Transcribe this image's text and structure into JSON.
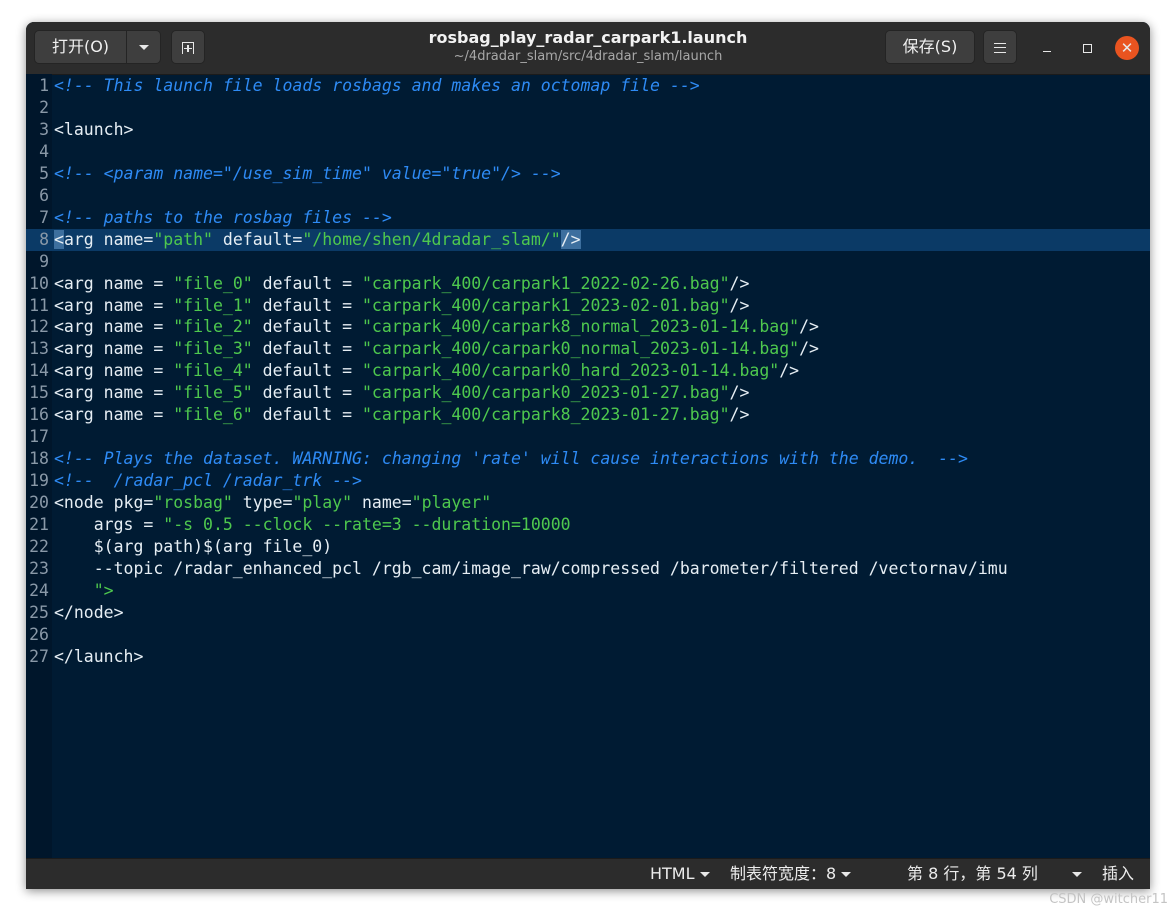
{
  "header": {
    "open_label": "打开(O)",
    "title": "rosbag_play_radar_carpark1.launch",
    "subtitle": "~/4dradar_slam/src/4dradar_slam/launch",
    "save_label": "保存(S)",
    "close_glyph": "✕"
  },
  "icons": [
    "chevron-down-icon",
    "new-tab-icon",
    "hamburger-menu-icon",
    "minimize-icon",
    "maximize-icon",
    "close-icon"
  ],
  "colors": {
    "editor_bg": "#001b33",
    "comment": "#2e8bf5",
    "string": "#4ec84e",
    "text": "#e6eef4",
    "current_line": "#0b3a66",
    "close_button": "#e95420"
  },
  "editor": {
    "current_line": 8,
    "lines": [
      {
        "n": "1",
        "t": "<!-- This launch file loads rosbags and makes an octomap file -->"
      },
      {
        "n": "2",
        "t": ""
      },
      {
        "n": "3",
        "t": "<launch>"
      },
      {
        "n": "4",
        "t": ""
      },
      {
        "n": "5",
        "t": "<!-- <param name=\"/use_sim_time\" value=\"true\"/> -->"
      },
      {
        "n": "6",
        "t": ""
      },
      {
        "n": "7",
        "t": "<!-- paths to the rosbag files -->"
      },
      {
        "n": "8",
        "t": "<arg name=\"path\" default=\"/home/shen/4dradar_slam/\"/>"
      },
      {
        "n": "9",
        "t": ""
      },
      {
        "n": "10",
        "t": "<arg name = \"file_0\" default = \"carpark_400/carpark1_2022-02-26.bag\"/>"
      },
      {
        "n": "11",
        "t": "<arg name = \"file_1\" default = \"carpark_400/carpark1_2023-02-01.bag\"/>"
      },
      {
        "n": "12",
        "t": "<arg name = \"file_2\" default = \"carpark_400/carpark8_normal_2023-01-14.bag\"/>"
      },
      {
        "n": "13",
        "t": "<arg name = \"file_3\" default = \"carpark_400/carpark0_normal_2023-01-14.bag\"/>"
      },
      {
        "n": "14",
        "t": "<arg name = \"file_4\" default = \"carpark_400/carpark0_hard_2023-01-14.bag\"/>"
      },
      {
        "n": "15",
        "t": "<arg name = \"file_5\" default = \"carpark_400/carpark0_2023-01-27.bag\"/>"
      },
      {
        "n": "16",
        "t": "<arg name = \"file_6\" default = \"carpark_400/carpark8_2023-01-27.bag\"/>"
      },
      {
        "n": "17",
        "t": ""
      },
      {
        "n": "18",
        "t": "<!-- Plays the dataset. WARNING: changing 'rate' will cause interactions with the demo.  -->"
      },
      {
        "n": "19",
        "t": "<!--  /radar_pcl /radar_trk -->"
      },
      {
        "n": "20",
        "t": "<node pkg=\"rosbag\" type=\"play\" name=\"player\""
      },
      {
        "n": "21",
        "t": "    args = \"-s 0.5 --clock --rate=3 --duration=10000"
      },
      {
        "n": "22",
        "t": "    $(arg path)$(arg file_0)"
      },
      {
        "n": "23",
        "t": "    --topic /radar_enhanced_pcl /rgb_cam/image_raw/compressed /barometer/filtered /vectornav/imu"
      },
      {
        "n": "24",
        "t": "    \">"
      },
      {
        "n": "25",
        "t": "</node>"
      },
      {
        "n": "26",
        "t": ""
      },
      {
        "n": "27",
        "t": "</launch>"
      }
    ]
  },
  "status": {
    "language": "HTML",
    "tab_width": "制表符宽度：8",
    "position": "第 8 行，第 54 列",
    "mode": "插入"
  },
  "watermark": "CSDN @witcher11"
}
